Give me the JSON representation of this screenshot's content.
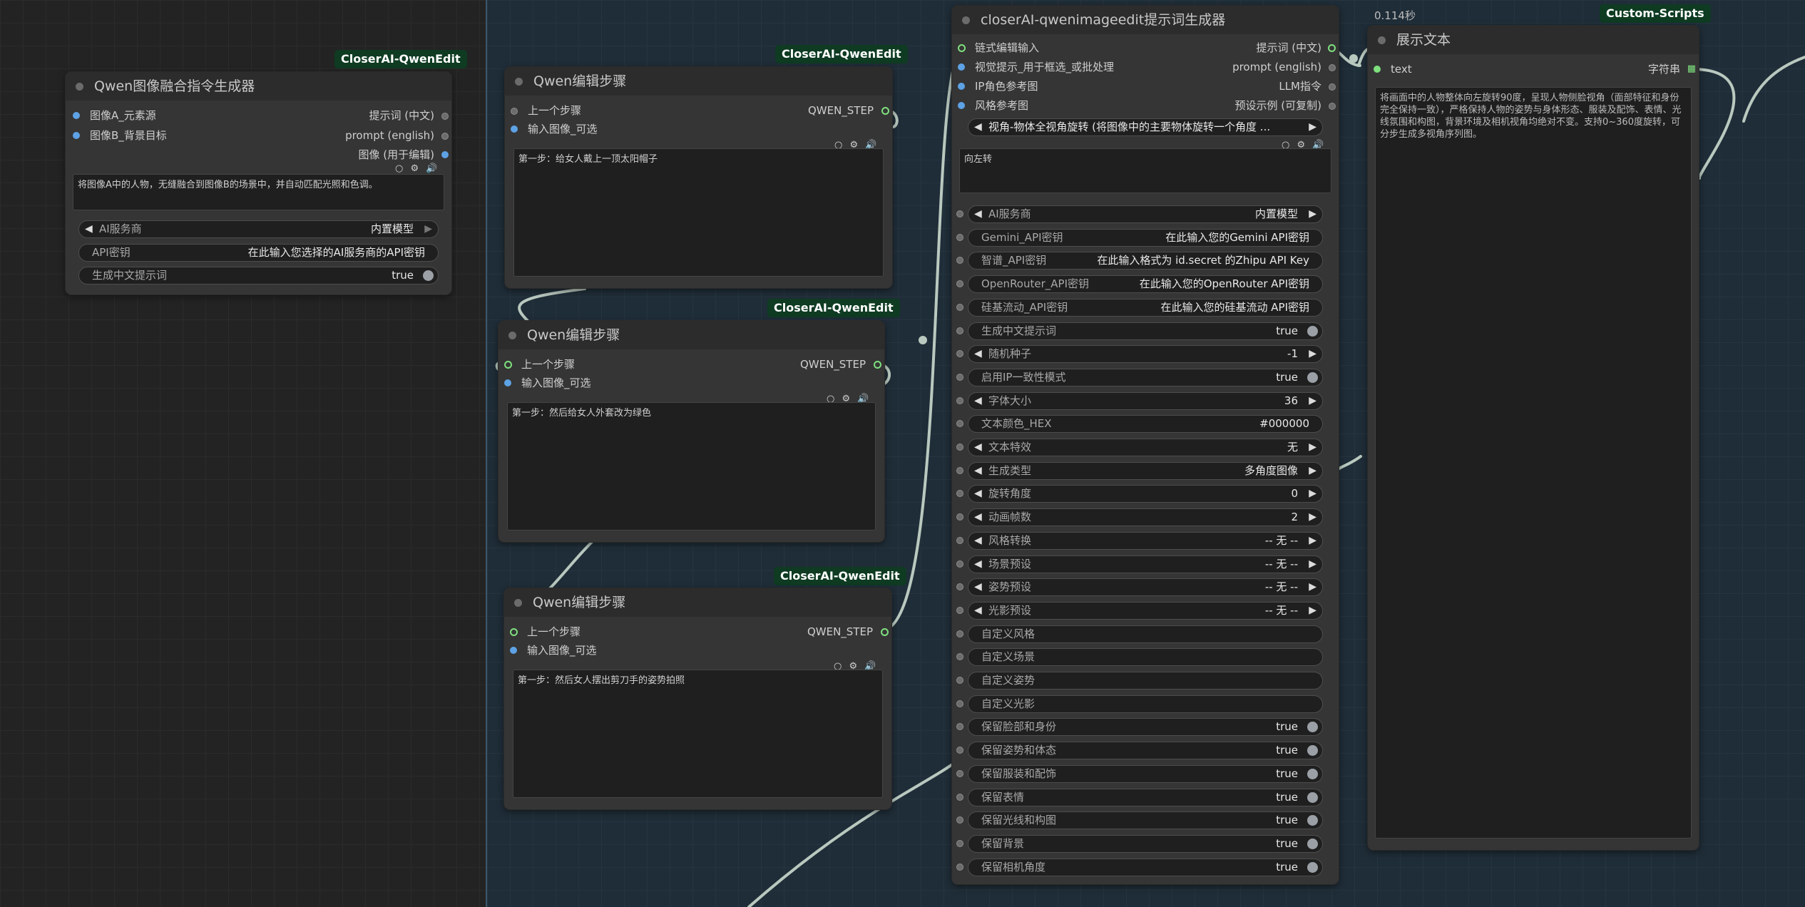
{
  "colors": {
    "badge_bg": "#0e3b22",
    "pin_blue": "#5ea2e6",
    "pin_green": "#7ee07e",
    "canvas_right": "#1f2d38"
  },
  "node1": {
    "badge": "CloserAI-QwenEdit",
    "title": "Qwen图像融合指令生成器",
    "inputs": [
      "图像A_元素源",
      "图像B_背景目标"
    ],
    "outputs": [
      "提示词 (中文)",
      "prompt (english)",
      "图像 (用于编辑)"
    ],
    "text": "将图像A中的人物，无缝融合到图像B的场景中，并自动匹配光照和色调。",
    "w_service_label": "AI服务商",
    "w_service_value": "内置模型",
    "w_apikey_label": "API密钥",
    "w_apikey_value": "在此输入您选择的AI服务商的API密钥",
    "w_cn_label": "生成中文提示词",
    "w_cn_value": "true"
  },
  "step1": {
    "badge": "CloserAI-QwenEdit",
    "title": "Qwen编辑步骤",
    "in_prev": "上一个步骤",
    "in_image": "输入图像_可选",
    "out": "QWEN_STEP",
    "text": "第一步：给女人戴上一顶太阳帽子"
  },
  "step2": {
    "badge": "CloserAI-QwenEdit",
    "title": "Qwen编辑步骤",
    "in_prev": "上一个步骤",
    "in_image": "输入图像_可选",
    "out": "QWEN_STEP",
    "text": "第一步：然后给女人外套改为绿色"
  },
  "step3": {
    "badge": "CloserAI-QwenEdit",
    "title": "Qwen编辑步骤",
    "in_prev": "上一个步骤",
    "in_image": "输入图像_可选",
    "out": "QWEN_STEP",
    "text": "第一步：然后女人摆出剪刀手的姿势拍照"
  },
  "main": {
    "title": "closerAI-qwenimageedit提示词生成器",
    "inputs": [
      "链式编辑输入",
      "视觉提示_用于框选_或批处理",
      "IP角色参考图",
      "风格参考图"
    ],
    "outputs": [
      "提示词 (中文)",
      "prompt (english)",
      "LLM指令",
      "预设示例 (可复制)"
    ],
    "preset_value": "视角-物体全视角旋转 (将图像中的主要物体旋转一个角度 ...",
    "text": "向左转",
    "widgets": [
      {
        "label": "AI服务商",
        "value": "内置模型",
        "kind": "combo"
      },
      {
        "label": "Gemini_API密钥",
        "value": "在此输入您的Gemini API密钥",
        "kind": "text"
      },
      {
        "label": "智谱_API密钥",
        "value": "在此输入格式为 id.secret 的Zhipu API Key",
        "kind": "text"
      },
      {
        "label": "OpenRouter_API密钥",
        "value": "在此输入您的OpenRouter API密钥",
        "kind": "text"
      },
      {
        "label": "硅基流动_API密钥",
        "value": "在此输入您的硅基流动 API密钥",
        "kind": "text"
      },
      {
        "label": "生成中文提示词",
        "value": "true",
        "kind": "toggle"
      },
      {
        "label": "随机种子",
        "value": "-1",
        "kind": "combo"
      },
      {
        "label": "启用IP一致性模式",
        "value": "true",
        "kind": "toggle"
      },
      {
        "label": "字体大小",
        "value": "36",
        "kind": "combo"
      },
      {
        "label": "文本颜色_HEX",
        "value": "#000000",
        "kind": "text"
      },
      {
        "label": "文本特效",
        "value": "无",
        "kind": "combo"
      },
      {
        "label": "生成类型",
        "value": "多角度图像",
        "kind": "combo"
      },
      {
        "label": "旋转角度",
        "value": "0",
        "kind": "combo"
      },
      {
        "label": "动画帧数",
        "value": "2",
        "kind": "combo"
      },
      {
        "label": "风格转换",
        "value": "-- 无 --",
        "kind": "combo"
      },
      {
        "label": "场景预设",
        "value": "-- 无 --",
        "kind": "combo"
      },
      {
        "label": "姿势预设",
        "value": "-- 无 --",
        "kind": "combo"
      },
      {
        "label": "光影预设",
        "value": "-- 无 --",
        "kind": "combo"
      },
      {
        "label": "自定义风格",
        "value": "",
        "kind": "text"
      },
      {
        "label": "自定义场景",
        "value": "",
        "kind": "text"
      },
      {
        "label": "自定义姿势",
        "value": "",
        "kind": "text"
      },
      {
        "label": "自定义光影",
        "value": "",
        "kind": "text"
      },
      {
        "label": "保留脸部和身份",
        "value": "true",
        "kind": "toggle"
      },
      {
        "label": "保留姿势和体态",
        "value": "true",
        "kind": "toggle"
      },
      {
        "label": "保留服装和配饰",
        "value": "true",
        "kind": "toggle"
      },
      {
        "label": "保留表情",
        "value": "true",
        "kind": "toggle"
      },
      {
        "label": "保留光线和构图",
        "value": "true",
        "kind": "toggle"
      },
      {
        "label": "保留背景",
        "value": "true",
        "kind": "toggle"
      },
      {
        "label": "保留相机角度",
        "value": "true",
        "kind": "toggle"
      }
    ]
  },
  "show": {
    "timing": "0.114秒",
    "badge": "Custom-Scripts",
    "title": "展示文本",
    "input": "text",
    "output": "字符串",
    "text": "将画面中的人物整体向左旋转90度，呈现人物侧脸视角（面部特征和身份完全保持一致），严格保持人物的姿势与身体形态、服装及配饰、表情、光线氛围和构图，背景环境及相机视角均绝对不变。支持0~360度旋转，可分步生成多视角序列图。"
  }
}
